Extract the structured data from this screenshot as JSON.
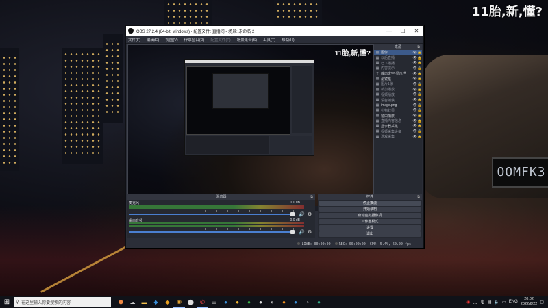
{
  "overlay": {
    "text": "11胎,新,懂?"
  },
  "car_plate": "OOMFK3",
  "obs": {
    "title": "OBS 27.2.4 (64-bit, windows) - 配置文件: 直播间 - 场景: 未命名 2",
    "window_controls": {
      "minimize": "—",
      "maximize": "☐",
      "close": "✕"
    },
    "menu": [
      "文件(F)",
      "编辑(E)",
      "视图(V)",
      "停靠窗口(D)",
      "配置文件(P)",
      "场景集合(S)",
      "工具(T)",
      "帮助(H)"
    ],
    "preview_overlay": "11胎,新,懂?",
    "sources_dock": {
      "title": "来源",
      "items": [
        {
          "icon": "▦",
          "name": "图像",
          "dim": false
        },
        {
          "icon": "▦",
          "name": "以后直播",
          "dim": true
        },
        {
          "icon": "▦",
          "name": "已下播播",
          "dim": true
        },
        {
          "icon": "▦",
          "name": "内容提示",
          "dim": true
        },
        {
          "icon": "T",
          "name": "静态文字-显示栏",
          "dim": false
        },
        {
          "icon": "▦",
          "name": "滤镜框",
          "dim": false
        },
        {
          "icon": "▦",
          "name": "图片1张",
          "dim": true
        },
        {
          "icon": "▦",
          "name": "新加播放",
          "dim": true
        },
        {
          "icon": "▦",
          "name": "视频播放",
          "dim": true
        },
        {
          "icon": "▦",
          "name": "设备捕获",
          "dim": true
        },
        {
          "icon": "▦",
          "name": "image.png",
          "dim": false
        },
        {
          "icon": "▦",
          "name": "礼物效果",
          "dim": true
        },
        {
          "icon": "▦",
          "name": "窗口捕获",
          "dim": false
        },
        {
          "icon": "▦",
          "name": "直播内容信息",
          "dim": true
        },
        {
          "icon": "▦",
          "name": "显示器采集",
          "dim": false
        },
        {
          "icon": "▦",
          "name": "视频采集设备",
          "dim": true
        },
        {
          "icon": "▦",
          "name": "游戏采集",
          "dim": true
        }
      ],
      "controls": [
        "+",
        "−",
        "⚙",
        "︿",
        "﹀"
      ]
    },
    "mixer": {
      "title": "混音器",
      "channels": [
        {
          "name": "麦克风",
          "db": "0.0 dB"
        },
        {
          "name": "桌面音频",
          "db": "0.0 dB"
        }
      ]
    },
    "controls_dock": {
      "title": "控件",
      "buttons": [
        "停止推流",
        "开始录制",
        "启动虚拟摄像机",
        "工作室模式",
        "设置",
        "退出"
      ]
    },
    "status": {
      "live": "LIVE: 00:00:00",
      "rec": "REC: 00:00:00",
      "cpu": "CPU: 5.4%, 60.00 fps"
    }
  },
  "taskbar": {
    "search_placeholder": "在这里输入你要搜索的内容",
    "lang": "ENG",
    "time": "20:02",
    "date": "2022/6/22"
  }
}
